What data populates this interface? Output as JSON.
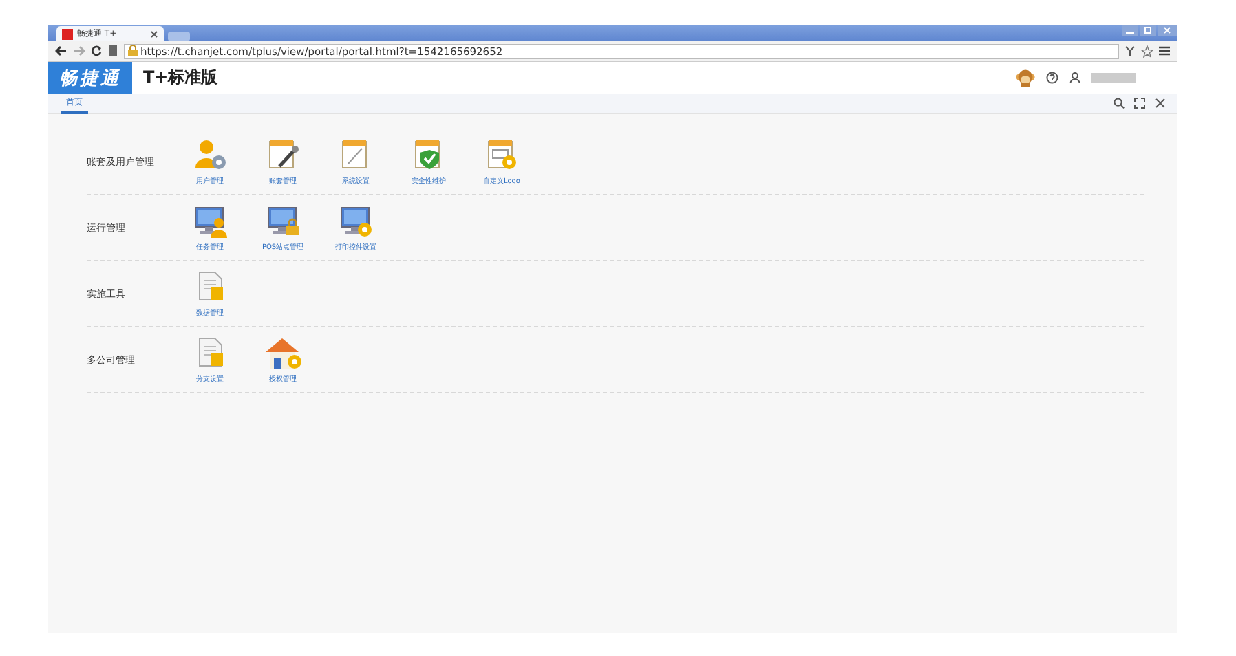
{
  "browser": {
    "tab_title": "畅捷通 T+",
    "address": "https://t.chanjet.com/tplus/view/portal/portal.html?t=1542165692652"
  },
  "header": {
    "logo": "畅捷通",
    "product": "T+标准版"
  },
  "tabs": [
    {
      "label": "首页",
      "selected": true
    }
  ],
  "groups": [
    {
      "title": "账套及用户管理",
      "items": [
        {
          "label": "用户管理",
          "kind": "users"
        },
        {
          "label": "账套管理",
          "kind": "tools"
        },
        {
          "label": "系统设置",
          "kind": "note"
        },
        {
          "label": "安全性维护",
          "kind": "shield"
        },
        {
          "label": "自定义Logo",
          "kind": "logo"
        }
      ]
    },
    {
      "title": "运行管理",
      "items": [
        {
          "label": "任务管理",
          "kind": "monitor-user"
        },
        {
          "label": "POS站点管理",
          "kind": "monitor-lock"
        },
        {
          "label": "打印控件设置",
          "kind": "monitor-gear"
        }
      ]
    },
    {
      "title": "实施工具",
      "items": [
        {
          "label": "数据管理",
          "kind": "doc"
        }
      ]
    },
    {
      "title": "多公司管理",
      "items": [
        {
          "label": "分支设置",
          "kind": "doc"
        },
        {
          "label": "授权管理",
          "kind": "house"
        }
      ]
    }
  ]
}
